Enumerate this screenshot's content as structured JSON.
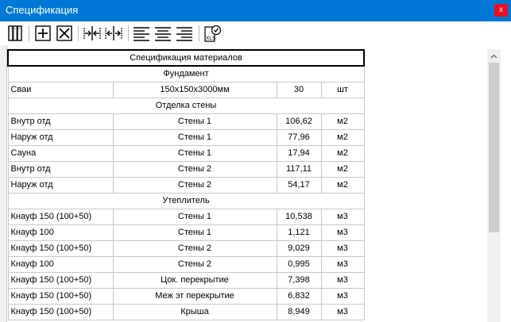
{
  "window": {
    "title": "Спецификация",
    "close_label": "x"
  },
  "toolbar": {
    "buttons": [
      {
        "icon": "columns-icon"
      },
      {
        "icon": "add-row-icon"
      },
      {
        "icon": "delete-row-icon"
      },
      {
        "icon": "collapse-columns-icon"
      },
      {
        "icon": "expand-columns-icon"
      },
      {
        "icon": "align-left-icon"
      },
      {
        "icon": "align-center-icon"
      },
      {
        "icon": "align-right-icon"
      },
      {
        "icon": "export-xls-icon",
        "label": "XLS"
      }
    ]
  },
  "table": {
    "header": "Спецификация материалов",
    "rows": [
      {
        "type": "section",
        "text": "Фундамент"
      },
      {
        "type": "item",
        "name": "Сваи",
        "location": "150x150x3000мм",
        "qty": "30",
        "unit": "шт"
      },
      {
        "type": "section",
        "text": "Отделка стены"
      },
      {
        "type": "item",
        "name": "Внутр отд",
        "location": "Стены 1",
        "qty": "106,62",
        "unit": "м2"
      },
      {
        "type": "item",
        "name": "Наруж отд",
        "location": "Стены 1",
        "qty": "77,96",
        "unit": "м2"
      },
      {
        "type": "item",
        "name": "Сауна",
        "location": "Стены 1",
        "qty": "17,94",
        "unit": "м2"
      },
      {
        "type": "item",
        "name": "Внутр отд",
        "location": "Стены 2",
        "qty": "117,11",
        "unit": "м2"
      },
      {
        "type": "item",
        "name": "Наруж отд",
        "location": "Стены 2",
        "qty": "54,17",
        "unit": "м2"
      },
      {
        "type": "section",
        "text": "Утеплитель"
      },
      {
        "type": "item",
        "name": "Кнауф 150 (100+50)",
        "location": "Стены 1",
        "qty": "10,538",
        "unit": "м3"
      },
      {
        "type": "item",
        "name": "Кнауф 100",
        "location": "Стены 1",
        "qty": "1,121",
        "unit": "м3"
      },
      {
        "type": "item",
        "name": "Кнауф 150 (100+50)",
        "location": "Стены 2",
        "qty": "9,029",
        "unit": "м3"
      },
      {
        "type": "item",
        "name": "Кнауф 100",
        "location": "Стены 2",
        "qty": "0,995",
        "unit": "м3"
      },
      {
        "type": "item",
        "name": "Кнауф 150 (100+50)",
        "location": "Цок. перекрытие",
        "qty": "7,398",
        "unit": "м3"
      },
      {
        "type": "item",
        "name": "Кнауф 150 (100+50)",
        "location": "Меж эт перекрытие",
        "qty": "6,832",
        "unit": "м3"
      },
      {
        "type": "item",
        "name": "Кнауф 150 (100+50)",
        "location": "Крыша",
        "qty": "8,949",
        "unit": "м3"
      }
    ]
  },
  "colors": {
    "titlebar": "#0078d7",
    "close_button": "#e81123",
    "grid_lines": "#c8c8c8",
    "scrollbar_thumb": "#cdcdcd"
  }
}
